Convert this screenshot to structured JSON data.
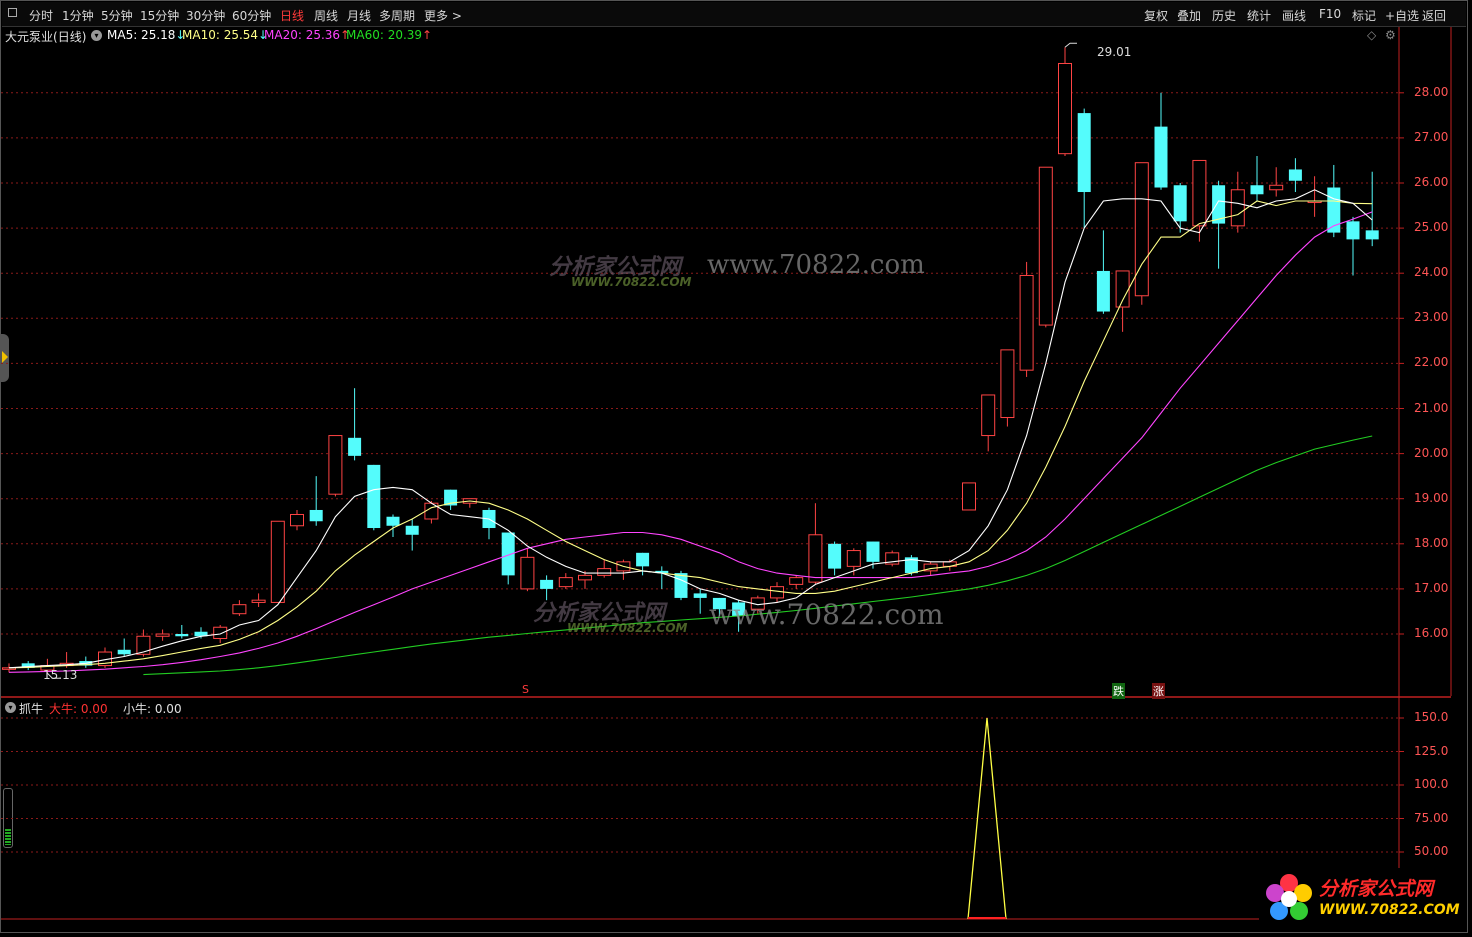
{
  "toolbar": {
    "periods": [
      "分时",
      "1分钟",
      "5分钟",
      "15分钟",
      "30分钟",
      "60分钟",
      "日线",
      "周线",
      "月线",
      "多周期",
      "更多"
    ],
    "active_period": "日线",
    "tools": [
      "复权",
      "叠加",
      "历史",
      "统计",
      "画线",
      "F10",
      "标记",
      "+自选",
      "返回"
    ]
  },
  "stock": {
    "name": "大元泵业",
    "period_label": "(日线)"
  },
  "ma": [
    {
      "label": "MA5: 25.18",
      "arrow": "↓",
      "color": "#ffffff"
    },
    {
      "label": "MA10: 25.54",
      "arrow": "↓",
      "color": "#ffff88"
    },
    {
      "label": "MA20: 25.36",
      "arrow": "↑",
      "color": "#ff44ff"
    },
    {
      "label": "MA60: 20.39",
      "arrow": "↑",
      "color": "#22cc22"
    }
  ],
  "main_axis": {
    "labels": [
      "28.00",
      "27.00",
      "26.00",
      "25.00",
      "24.00",
      "23.00",
      "22.00",
      "21.00",
      "20.00",
      "19.00",
      "18.00",
      "17.00",
      "16.00"
    ]
  },
  "annotations": {
    "high": "29.01",
    "low": "15.13",
    "marker_s": "S",
    "marker_die": "跌",
    "marker_zhang": "涨"
  },
  "indicator": {
    "name": "抓牛",
    "big_label": "大牛: 0.00",
    "small_label": "小牛: 0.00",
    "axis": [
      "150.0",
      "125.0",
      "100.0",
      "75.00",
      "50.00"
    ],
    "peak_value": 150
  },
  "watermark": {
    "cn": "分析家公式网",
    "url_text": "www.70822.com",
    "url_sub": "WWW.70822.COM"
  },
  "logo": {
    "cn": "分析家公式网",
    "url": "WWW.70822.COM"
  },
  "colors": {
    "up": "#ff4444",
    "down": "#54fcfc",
    "ma5": "#ffffff",
    "ma10": "#ffff88",
    "ma20": "#ff44ff",
    "ma60": "#22cc22",
    "grid": "#8b1a1a"
  },
  "chart_data": {
    "type": "candlestick",
    "title": "大元泵业(日线)",
    "ylim": [
      15.0,
      29.2
    ],
    "candles": [
      [
        15.25,
        15.25,
        15.35,
        15.15
      ],
      [
        15.35,
        15.25,
        15.4,
        15.2
      ],
      [
        15.2,
        15.3,
        15.45,
        15.13
      ],
      [
        15.3,
        15.35,
        15.6,
        15.25
      ],
      [
        15.4,
        15.3,
        15.5,
        15.25
      ],
      [
        15.3,
        15.6,
        15.7,
        15.25
      ],
      [
        15.65,
        15.55,
        15.9,
        15.5
      ],
      [
        15.55,
        15.95,
        16.1,
        15.5
      ],
      [
        15.95,
        16.0,
        16.1,
        15.85
      ],
      [
        16.0,
        15.95,
        16.2,
        15.9
      ],
      [
        16.05,
        15.95,
        16.15,
        15.9
      ],
      [
        15.9,
        16.15,
        16.2,
        15.8
      ],
      [
        16.45,
        16.65,
        16.75,
        16.4
      ],
      [
        16.7,
        16.75,
        16.9,
        16.6
      ],
      [
        16.7,
        18.5,
        18.5,
        16.7
      ],
      [
        18.4,
        18.65,
        18.75,
        18.3
      ],
      [
        18.75,
        18.5,
        19.5,
        18.4
      ],
      [
        19.1,
        20.4,
        20.4,
        19.05
      ],
      [
        20.35,
        19.95,
        21.45,
        19.85
      ],
      [
        19.75,
        18.35,
        19.75,
        18.3
      ],
      [
        18.6,
        18.4,
        18.65,
        18.15
      ],
      [
        18.4,
        18.2,
        18.55,
        17.85
      ],
      [
        18.55,
        18.9,
        18.95,
        18.45
      ],
      [
        19.2,
        18.85,
        19.2,
        18.75
      ],
      [
        18.9,
        19.0,
        19.0,
        18.8
      ],
      [
        18.75,
        18.35,
        18.8,
        18.1
      ],
      [
        18.25,
        17.3,
        18.25,
        17.1
      ],
      [
        17.0,
        17.7,
        17.9,
        16.95
      ],
      [
        17.2,
        17.0,
        17.3,
        16.75
      ],
      [
        17.05,
        17.25,
        17.35,
        17.0
      ],
      [
        17.2,
        17.3,
        17.4,
        17.0
      ],
      [
        17.3,
        17.45,
        17.65,
        17.25
      ],
      [
        17.4,
        17.6,
        17.65,
        17.2
      ],
      [
        17.8,
        17.5,
        17.8,
        17.3
      ],
      [
        17.4,
        17.35,
        17.5,
        17.0
      ],
      [
        17.35,
        16.8,
        17.4,
        16.75
      ],
      [
        16.9,
        16.8,
        17.0,
        16.45
      ],
      [
        16.8,
        16.55,
        16.8,
        16.4
      ],
      [
        16.7,
        16.4,
        16.75,
        16.05
      ],
      [
        16.55,
        16.8,
        16.85,
        16.45
      ],
      [
        16.8,
        17.05,
        17.15,
        16.7
      ],
      [
        17.1,
        17.25,
        17.3,
        17.0
      ],
      [
        17.15,
        18.2,
        18.9,
        17.1
      ],
      [
        18.0,
        17.45,
        18.05,
        17.3
      ],
      [
        17.5,
        17.85,
        17.9,
        17.3
      ],
      [
        18.05,
        17.6,
        18.05,
        17.45
      ],
      [
        17.55,
        17.8,
        17.85,
        17.5
      ],
      [
        17.7,
        17.35,
        17.75,
        17.3
      ],
      [
        17.4,
        17.55,
        17.6,
        17.3
      ],
      [
        17.5,
        17.6,
        17.65,
        17.4
      ],
      [
        18.75,
        19.35,
        19.35,
        18.75
      ],
      [
        20.4,
        21.3,
        21.3,
        20.05
      ],
      [
        20.8,
        22.3,
        22.3,
        20.6
      ],
      [
        21.85,
        23.95,
        24.25,
        21.7
      ],
      [
        22.85,
        26.35,
        26.35,
        22.8
      ],
      [
        26.65,
        28.65,
        29.01,
        26.6
      ],
      [
        27.55,
        25.8,
        27.65,
        25.0
      ],
      [
        24.05,
        23.15,
        24.95,
        23.1
      ],
      [
        23.25,
        24.05,
        24.05,
        22.7
      ],
      [
        23.5,
        26.45,
        26.45,
        23.3
      ],
      [
        27.25,
        25.9,
        28.0,
        25.85
      ],
      [
        25.95,
        25.15,
        26.0,
        24.9
      ],
      [
        25.05,
        26.5,
        26.5,
        24.7
      ],
      [
        25.95,
        25.1,
        26.05,
        24.1
      ],
      [
        25.05,
        25.85,
        26.25,
        24.9
      ],
      [
        25.95,
        25.75,
        26.6,
        25.6
      ],
      [
        25.85,
        25.95,
        26.35,
        25.7
      ],
      [
        26.3,
        26.05,
        26.55,
        25.8
      ],
      [
        25.6,
        25.6,
        26.15,
        25.25
      ],
      [
        25.9,
        24.9,
        26.4,
        24.8
      ],
      [
        25.15,
        24.75,
        25.25,
        23.95
      ],
      [
        24.95,
        24.75,
        26.25,
        24.6
      ]
    ],
    "ma5": [
      15.25,
      15.28,
      15.3,
      15.32,
      15.35,
      15.43,
      15.5,
      15.6,
      15.73,
      15.85,
      15.95,
      16.0,
      16.2,
      16.3,
      16.65,
      17.25,
      17.85,
      18.6,
      19.05,
      19.2,
      19.25,
      19.2,
      18.9,
      18.65,
      18.6,
      18.55,
      18.3,
      17.95,
      17.7,
      17.5,
      17.35,
      17.35,
      17.35,
      17.4,
      17.35,
      17.2,
      17.0,
      16.9,
      16.75,
      16.65,
      16.7,
      16.8,
      17.1,
      17.25,
      17.4,
      17.55,
      17.6,
      17.65,
      17.6,
      17.6,
      17.85,
      18.4,
      19.2,
      20.4,
      22.0,
      23.8,
      25.0,
      25.6,
      25.65,
      25.65,
      25.6,
      25.0,
      24.9,
      25.6,
      25.55,
      25.45,
      25.6,
      25.65,
      25.85,
      25.65,
      25.55,
      25.18
    ],
    "ma10": [
      15.25,
      15.26,
      15.28,
      15.3,
      15.32,
      15.35,
      15.4,
      15.45,
      15.52,
      15.6,
      15.68,
      15.75,
      15.88,
      16.05,
      16.3,
      16.6,
      16.95,
      17.4,
      17.75,
      18.05,
      18.35,
      18.55,
      18.8,
      18.9,
      18.95,
      18.9,
      18.75,
      18.55,
      18.3,
      18.05,
      17.85,
      17.65,
      17.5,
      17.4,
      17.35,
      17.3,
      17.25,
      17.15,
      17.05,
      17.0,
      16.95,
      16.9,
      16.9,
      16.95,
      17.05,
      17.15,
      17.25,
      17.35,
      17.45,
      17.5,
      17.6,
      17.85,
      18.3,
      18.9,
      19.7,
      20.6,
      21.6,
      22.5,
      23.4,
      24.2,
      24.8,
      24.8,
      25.1,
      25.2,
      25.3,
      25.6,
      25.5,
      25.6,
      25.6,
      25.6,
      25.55,
      25.54
    ],
    "ma20": [
      15.15,
      15.16,
      15.17,
      15.18,
      15.2,
      15.22,
      15.25,
      15.28,
      15.32,
      15.37,
      15.43,
      15.5,
      15.58,
      15.68,
      15.8,
      15.95,
      16.12,
      16.3,
      16.48,
      16.65,
      16.82,
      17.0,
      17.15,
      17.3,
      17.45,
      17.6,
      17.75,
      17.9,
      18.0,
      18.1,
      18.15,
      18.2,
      18.25,
      18.25,
      18.2,
      18.1,
      17.95,
      17.8,
      17.6,
      17.45,
      17.35,
      17.3,
      17.25,
      17.25,
      17.25,
      17.25,
      17.25,
      17.25,
      17.3,
      17.35,
      17.4,
      17.5,
      17.65,
      17.85,
      18.15,
      18.55,
      19.0,
      19.45,
      19.9,
      20.35,
      20.9,
      21.45,
      21.95,
      22.45,
      22.95,
      23.45,
      23.95,
      24.4,
      24.8,
      25.05,
      25.2,
      25.36
    ],
    "ma60": [
      null,
      null,
      null,
      null,
      null,
      null,
      null,
      15.1,
      15.12,
      15.14,
      15.16,
      15.18,
      15.21,
      15.25,
      15.3,
      15.36,
      15.42,
      15.48,
      15.54,
      15.6,
      15.66,
      15.72,
      15.78,
      15.83,
      15.88,
      15.93,
      15.97,
      16.01,
      16.05,
      16.09,
      16.13,
      16.17,
      16.21,
      16.25,
      16.28,
      16.31,
      16.34,
      16.37,
      16.4,
      16.44,
      16.48,
      16.52,
      16.57,
      16.62,
      16.67,
      16.72,
      16.77,
      16.82,
      16.88,
      16.94,
      17.0,
      17.08,
      17.18,
      17.3,
      17.45,
      17.63,
      17.83,
      18.03,
      18.23,
      18.43,
      18.63,
      18.83,
      19.03,
      19.23,
      19.43,
      19.63,
      19.8,
      19.95,
      20.1,
      20.2,
      20.3,
      20.39
    ]
  }
}
